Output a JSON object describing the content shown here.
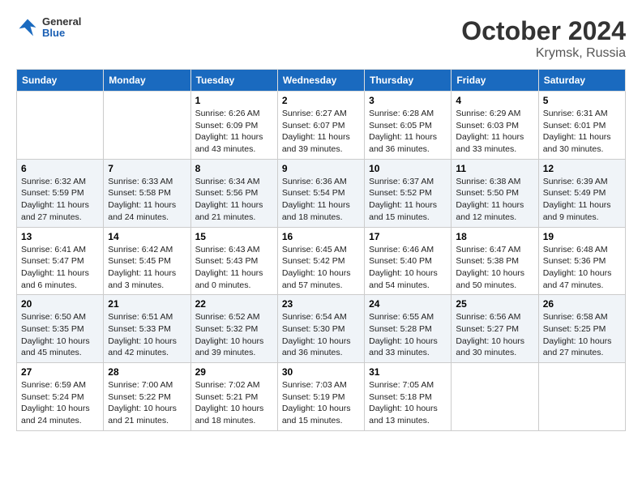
{
  "header": {
    "logo": {
      "general": "General",
      "blue": "Blue"
    },
    "title": "October 2024",
    "location": "Krymsk, Russia"
  },
  "calendar": {
    "weekdays": [
      "Sunday",
      "Monday",
      "Tuesday",
      "Wednesday",
      "Thursday",
      "Friday",
      "Saturday"
    ],
    "weeks": [
      [
        {
          "day": "",
          "sunrise": "",
          "sunset": "",
          "daylight": ""
        },
        {
          "day": "",
          "sunrise": "",
          "sunset": "",
          "daylight": ""
        },
        {
          "day": "1",
          "sunrise": "Sunrise: 6:26 AM",
          "sunset": "Sunset: 6:09 PM",
          "daylight": "Daylight: 11 hours and 43 minutes."
        },
        {
          "day": "2",
          "sunrise": "Sunrise: 6:27 AM",
          "sunset": "Sunset: 6:07 PM",
          "daylight": "Daylight: 11 hours and 39 minutes."
        },
        {
          "day": "3",
          "sunrise": "Sunrise: 6:28 AM",
          "sunset": "Sunset: 6:05 PM",
          "daylight": "Daylight: 11 hours and 36 minutes."
        },
        {
          "day": "4",
          "sunrise": "Sunrise: 6:29 AM",
          "sunset": "Sunset: 6:03 PM",
          "daylight": "Daylight: 11 hours and 33 minutes."
        },
        {
          "day": "5",
          "sunrise": "Sunrise: 6:31 AM",
          "sunset": "Sunset: 6:01 PM",
          "daylight": "Daylight: 11 hours and 30 minutes."
        }
      ],
      [
        {
          "day": "6",
          "sunrise": "Sunrise: 6:32 AM",
          "sunset": "Sunset: 5:59 PM",
          "daylight": "Daylight: 11 hours and 27 minutes."
        },
        {
          "day": "7",
          "sunrise": "Sunrise: 6:33 AM",
          "sunset": "Sunset: 5:58 PM",
          "daylight": "Daylight: 11 hours and 24 minutes."
        },
        {
          "day": "8",
          "sunrise": "Sunrise: 6:34 AM",
          "sunset": "Sunset: 5:56 PM",
          "daylight": "Daylight: 11 hours and 21 minutes."
        },
        {
          "day": "9",
          "sunrise": "Sunrise: 6:36 AM",
          "sunset": "Sunset: 5:54 PM",
          "daylight": "Daylight: 11 hours and 18 minutes."
        },
        {
          "day": "10",
          "sunrise": "Sunrise: 6:37 AM",
          "sunset": "Sunset: 5:52 PM",
          "daylight": "Daylight: 11 hours and 15 minutes."
        },
        {
          "day": "11",
          "sunrise": "Sunrise: 6:38 AM",
          "sunset": "Sunset: 5:50 PM",
          "daylight": "Daylight: 11 hours and 12 minutes."
        },
        {
          "day": "12",
          "sunrise": "Sunrise: 6:39 AM",
          "sunset": "Sunset: 5:49 PM",
          "daylight": "Daylight: 11 hours and 9 minutes."
        }
      ],
      [
        {
          "day": "13",
          "sunrise": "Sunrise: 6:41 AM",
          "sunset": "Sunset: 5:47 PM",
          "daylight": "Daylight: 11 hours and 6 minutes."
        },
        {
          "day": "14",
          "sunrise": "Sunrise: 6:42 AM",
          "sunset": "Sunset: 5:45 PM",
          "daylight": "Daylight: 11 hours and 3 minutes."
        },
        {
          "day": "15",
          "sunrise": "Sunrise: 6:43 AM",
          "sunset": "Sunset: 5:43 PM",
          "daylight": "Daylight: 11 hours and 0 minutes."
        },
        {
          "day": "16",
          "sunrise": "Sunrise: 6:45 AM",
          "sunset": "Sunset: 5:42 PM",
          "daylight": "Daylight: 10 hours and 57 minutes."
        },
        {
          "day": "17",
          "sunrise": "Sunrise: 6:46 AM",
          "sunset": "Sunset: 5:40 PM",
          "daylight": "Daylight: 10 hours and 54 minutes."
        },
        {
          "day": "18",
          "sunrise": "Sunrise: 6:47 AM",
          "sunset": "Sunset: 5:38 PM",
          "daylight": "Daylight: 10 hours and 50 minutes."
        },
        {
          "day": "19",
          "sunrise": "Sunrise: 6:48 AM",
          "sunset": "Sunset: 5:36 PM",
          "daylight": "Daylight: 10 hours and 47 minutes."
        }
      ],
      [
        {
          "day": "20",
          "sunrise": "Sunrise: 6:50 AM",
          "sunset": "Sunset: 5:35 PM",
          "daylight": "Daylight: 10 hours and 45 minutes."
        },
        {
          "day": "21",
          "sunrise": "Sunrise: 6:51 AM",
          "sunset": "Sunset: 5:33 PM",
          "daylight": "Daylight: 10 hours and 42 minutes."
        },
        {
          "day": "22",
          "sunrise": "Sunrise: 6:52 AM",
          "sunset": "Sunset: 5:32 PM",
          "daylight": "Daylight: 10 hours and 39 minutes."
        },
        {
          "day": "23",
          "sunrise": "Sunrise: 6:54 AM",
          "sunset": "Sunset: 5:30 PM",
          "daylight": "Daylight: 10 hours and 36 minutes."
        },
        {
          "day": "24",
          "sunrise": "Sunrise: 6:55 AM",
          "sunset": "Sunset: 5:28 PM",
          "daylight": "Daylight: 10 hours and 33 minutes."
        },
        {
          "day": "25",
          "sunrise": "Sunrise: 6:56 AM",
          "sunset": "Sunset: 5:27 PM",
          "daylight": "Daylight: 10 hours and 30 minutes."
        },
        {
          "day": "26",
          "sunrise": "Sunrise: 6:58 AM",
          "sunset": "Sunset: 5:25 PM",
          "daylight": "Daylight: 10 hours and 27 minutes."
        }
      ],
      [
        {
          "day": "27",
          "sunrise": "Sunrise: 6:59 AM",
          "sunset": "Sunset: 5:24 PM",
          "daylight": "Daylight: 10 hours and 24 minutes."
        },
        {
          "day": "28",
          "sunrise": "Sunrise: 7:00 AM",
          "sunset": "Sunset: 5:22 PM",
          "daylight": "Daylight: 10 hours and 21 minutes."
        },
        {
          "day": "29",
          "sunrise": "Sunrise: 7:02 AM",
          "sunset": "Sunset: 5:21 PM",
          "daylight": "Daylight: 10 hours and 18 minutes."
        },
        {
          "day": "30",
          "sunrise": "Sunrise: 7:03 AM",
          "sunset": "Sunset: 5:19 PM",
          "daylight": "Daylight: 10 hours and 15 minutes."
        },
        {
          "day": "31",
          "sunrise": "Sunrise: 7:05 AM",
          "sunset": "Sunset: 5:18 PM",
          "daylight": "Daylight: 10 hours and 13 minutes."
        },
        {
          "day": "",
          "sunrise": "",
          "sunset": "",
          "daylight": ""
        },
        {
          "day": "",
          "sunrise": "",
          "sunset": "",
          "daylight": ""
        }
      ]
    ]
  }
}
